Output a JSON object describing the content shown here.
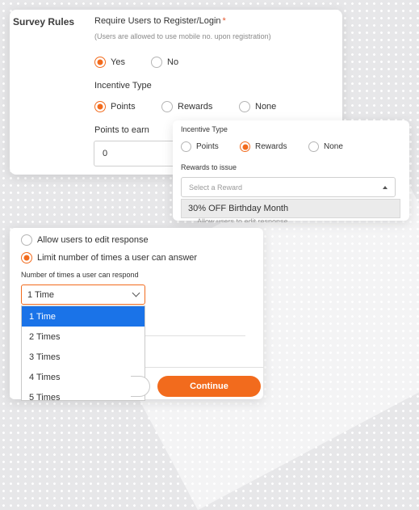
{
  "survey_rules": {
    "section_title": "Survey Rules",
    "require_label": "Require Users to Register/Login",
    "required_mark": "*",
    "require_hint": "(Users are allowed to use mobile no. upon registration)",
    "yes_label": "Yes",
    "no_label": "No",
    "incentive_label": "Incentive Type",
    "points_label": "Points",
    "rewards_label": "Rewards",
    "none_label": "None",
    "points_to_earn_label": "Points to earn",
    "points_value": "0"
  },
  "reward_panel": {
    "incentive_label": "Incentive Type",
    "points_label": "Points",
    "rewards_label": "Rewards",
    "none_label": "None",
    "rewards_to_issue_label": "Rewards to issue",
    "select_placeholder": "Select a Reward",
    "option": "30% OFF Birthday Month",
    "partial_text": "Allow users to edit response"
  },
  "response_panel": {
    "edit_response_label": "Allow users to edit response",
    "limit_label": "Limit number of times a user can answer",
    "times_label": "Number of times a user can respond",
    "selected_value": "1 Time",
    "options": [
      "1 Time",
      "2 Times",
      "3 Times",
      "4 Times",
      "5 Times"
    ],
    "continue_label": "Continue"
  },
  "colors": {
    "accent": "#f26b1d",
    "selected_option": "#1a73e8"
  }
}
